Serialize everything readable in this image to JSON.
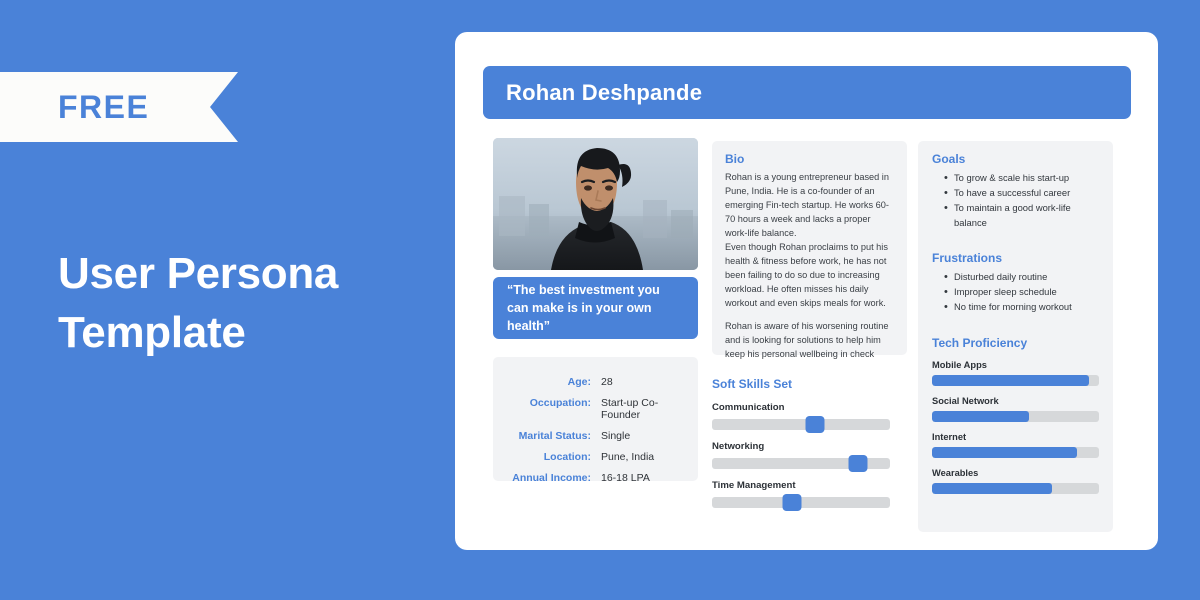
{
  "promo": {
    "ribbon_label": "FREE",
    "title_line1": "User Persona",
    "title_line2": "Template",
    "background_color": "#4a82d8",
    "accent_color": "#4a82d8"
  },
  "card": {
    "persona_name": "Rohan Deshpande",
    "photo_alt": "portrait-of-bearded-man-outdoors",
    "quote": "“The best investment you can make is in your own health”",
    "details": {
      "rows": [
        {
          "label": "Age:",
          "value": "28"
        },
        {
          "label": "Occupation:",
          "value": "Start-up Co-Founder"
        },
        {
          "label": "Marital Status:",
          "value": "Single"
        },
        {
          "label": "Location:",
          "value": "Pune, India"
        },
        {
          "label": "Annual Income:",
          "value": "16-18 LPA"
        }
      ]
    },
    "bio": {
      "heading": "Bio",
      "paragraph1": "Rohan is a young entrepreneur based in Pune, India. He is a co-founder of an emerging Fin-tech startup. He works 60-70 hours a week and lacks a proper work-life balance.",
      "paragraph2": "Even though Rohan proclaims to put his health & fitness before work, he has not been failing to do so due to increasing workload. He often misses his daily workout and even skips meals for work.",
      "paragraph3": "Rohan is aware of his worsening routine and is looking for solutions to help him keep his personal wellbeing in check"
    },
    "soft_skills": {
      "heading": "Soft Skills Set",
      "items": [
        {
          "label": "Communication",
          "value": 58
        },
        {
          "label": "Networking",
          "value": 82
        },
        {
          "label": "Time Management",
          "value": 45
        }
      ]
    },
    "goals": {
      "heading": "Goals",
      "items": [
        "To grow & scale his start-up",
        "To have a successful career",
        "To maintain a good work-life balance"
      ]
    },
    "frustrations": {
      "heading": "Frustrations",
      "items": [
        "Disturbed daily routine",
        "Improper sleep schedule",
        "No time for morning workout"
      ]
    },
    "tech_proficiency": {
      "heading": "Tech Proficiency",
      "items": [
        {
          "label": "Mobile Apps",
          "value": 94
        },
        {
          "label": "Social Network",
          "value": 58
        },
        {
          "label": "Internet",
          "value": 87
        },
        {
          "label": "Wearables",
          "value": 72
        }
      ]
    }
  }
}
